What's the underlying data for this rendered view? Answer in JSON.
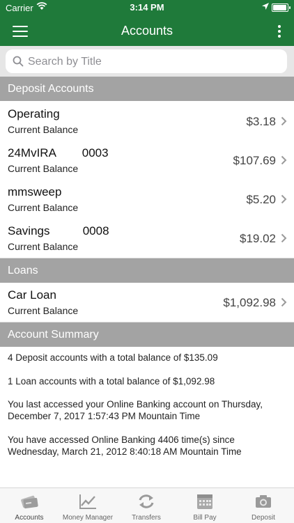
{
  "status_bar": {
    "carrier": "Carrier",
    "time": "3:14 PM"
  },
  "nav": {
    "title": "Accounts"
  },
  "search": {
    "placeholder": "Search by Title"
  },
  "deposit_section": {
    "title": "Deposit Accounts",
    "accounts": [
      {
        "name": "Operating",
        "sub": "Current Balance",
        "amount": "$3.18"
      },
      {
        "name": "24MvIRA        0003",
        "sub": "Current Balance",
        "amount": "$107.69"
      },
      {
        "name": "mmsweep",
        "sub": "Current Balance",
        "amount": "$5.20"
      },
      {
        "name": "Savings          0008",
        "sub": "Current Balance",
        "amount": "$19.02"
      }
    ]
  },
  "loans_section": {
    "title": "Loans",
    "accounts": [
      {
        "name": "Car Loan",
        "sub": "Current Balance",
        "amount": "$1,092.98"
      }
    ]
  },
  "summary_section": {
    "title": "Account Summary",
    "lines": [
      "4 Deposit accounts with a total balance of $135.09",
      "1 Loan accounts with a total balance of $1,092.98",
      "You last accessed your Online Banking account on Thursday, December 7, 2017 1:57:43 PM Mountain Time",
      "You have accessed Online Banking 4406 time(s) since Wednesday, March 21, 2012 8:40:18 AM Mountain Time"
    ]
  },
  "tabs": [
    {
      "label": "Accounts",
      "icon": "accounts-card-icon"
    },
    {
      "label": "Money Manager",
      "icon": "chart-line-icon"
    },
    {
      "label": "Transfers",
      "icon": "transfer-arrows-icon"
    },
    {
      "label": "Bill Pay",
      "icon": "calendar-icon"
    },
    {
      "label": "Deposit",
      "icon": "camera-icon"
    }
  ],
  "colors": {
    "brand_green": "#1f7a3a",
    "section_gray": "#a3a3a3"
  }
}
